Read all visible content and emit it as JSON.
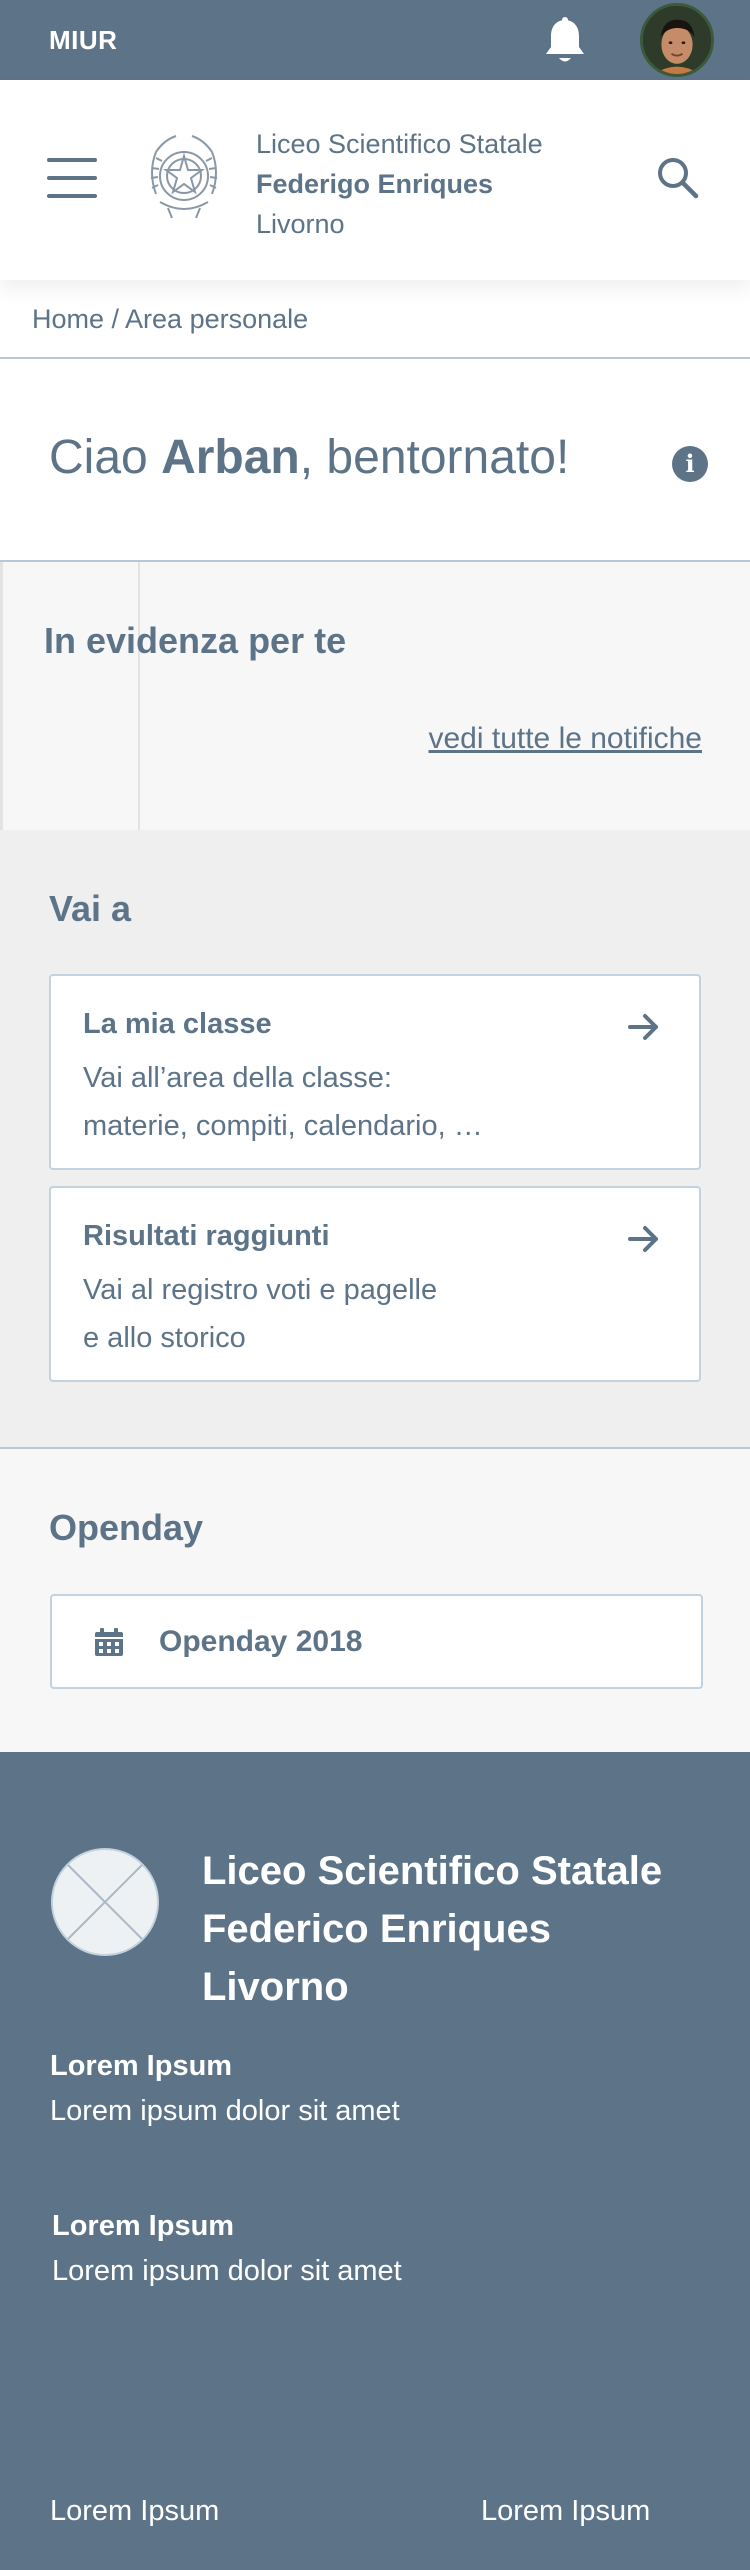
{
  "topbar": {
    "brand": "MIUR",
    "bell_icon": "bell-icon",
    "avatar": "user-avatar"
  },
  "header": {
    "menu_icon": "hamburger-menu-icon",
    "emblem": "italian-republic-emblem",
    "school_line1": "Liceo Scientifico Statale",
    "school_line2": "Federigo Enriques",
    "school_line3": "Livorno",
    "search_icon": "search-icon"
  },
  "breadcrumb": "Home / Area personale",
  "greeting": {
    "prefix": "Ciao ",
    "name": "Arban",
    "suffix": ", bentornato!",
    "info_icon": "info-icon"
  },
  "evidenza": {
    "title": "In evidenza per te",
    "link": "vedi tutte le notifiche"
  },
  "vaia": {
    "title": "Vai a",
    "cards": [
      {
        "title": "La mia classe",
        "line1": "Vai all’area della classe:",
        "line2": "materie, compiti, calendario, …",
        "icon": "arrow-right-icon"
      },
      {
        "title": "Risultati raggiunti",
        "line1": "Vai al registro voti e pagelle",
        "line2": "e allo storico",
        "icon": "arrow-right-icon"
      }
    ]
  },
  "openday": {
    "title": "Openday",
    "item": "Openday 2018",
    "icon": "calendar-icon"
  },
  "footer": {
    "logo": "placeholder-logo",
    "name_line1": "Liceo Scientifico Statale",
    "name_line2": "Federico Enriques",
    "name_line3": "Livorno",
    "sections": [
      {
        "heading": "Lorem Ipsum",
        "text": "Lorem ipsum dolor sit amet"
      },
      {
        "heading": "Lorem Ipsum",
        "text": "Lorem ipsum dolor sit amet"
      }
    ],
    "bottom_left": "Lorem Ipsum",
    "bottom_right": "Lorem Ipsum"
  },
  "colors": {
    "primary": "#5c7388",
    "border": "#c3d2df",
    "bg_light": "#f7f7f7",
    "bg_grey": "#efefef"
  }
}
